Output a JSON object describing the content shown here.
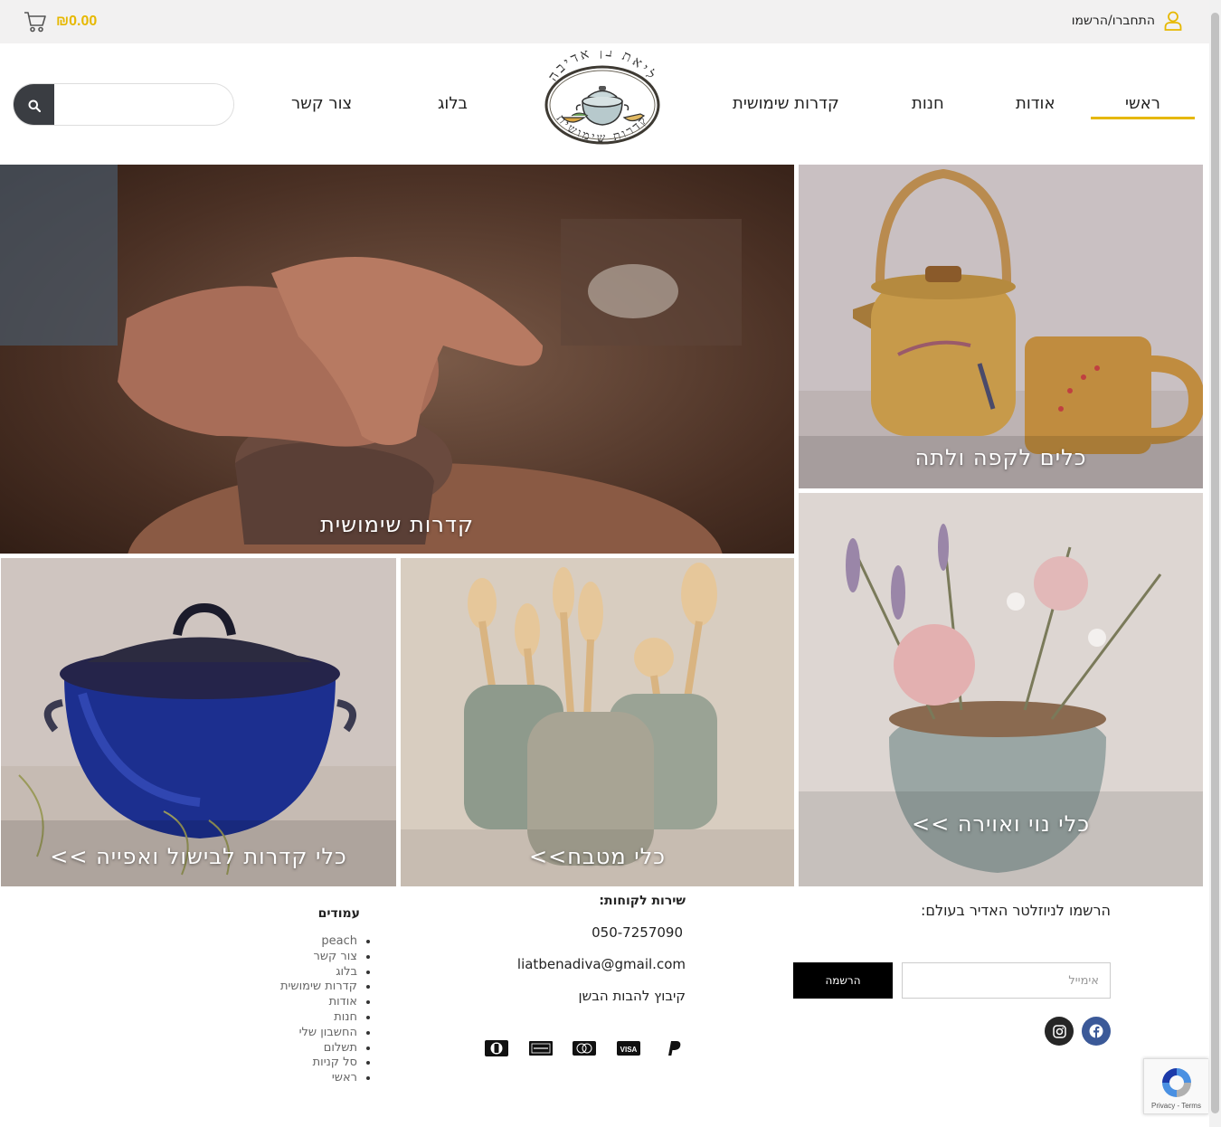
{
  "topbar": {
    "cart_total": "₪0.00",
    "account_label": "התחברו/הרשמו",
    "icons": [
      "cart-icon",
      "user-icon"
    ]
  },
  "header": {
    "logo_name": "ליאת בן אדיבה",
    "logo_tagline": "קדרות שימושית",
    "search_placeholder": "",
    "nav": {
      "home": "ראשי",
      "about": "אודות",
      "shop": "חנות",
      "pottery": "קדרות שימושית",
      "blog": "בלוג",
      "contact": "צור קשר"
    },
    "accent_color": "#e6b800"
  },
  "tiles": {
    "pottery": "קדרות שימושית",
    "coffee_tea": "כלים לקפה ולתה",
    "decor": "כלי נוי ואוירה >>",
    "kitchen": "כלי מטבח>>",
    "cooking": "כלי קדרות לבישול ואפייה >>"
  },
  "footer": {
    "newsletter_title": "הרשמו לניוזלטר האדיר בעולם:",
    "email_placeholder": "אימייל",
    "subscribe_label": "הרשמה",
    "service_title": "שירות לקוחות:",
    "phone": "050-7257090",
    "email": "liatbenadiva@gmail.com",
    "address": "קיבוץ להבות הבשן",
    "payment_icons": [
      "paypal-icon",
      "visa-icon",
      "mastercard-icon",
      "amex-icon",
      "diners-icon"
    ],
    "pages_title": "עמודים",
    "pages": [
      "peach",
      "צור קשר",
      "בלוג",
      "קדרות שימושית",
      "אודות",
      "חנות",
      "החשבון שלי",
      "תשלום",
      "סל קניות",
      "ראשי"
    ],
    "social_icons": [
      "facebook-icon",
      "instagram-icon"
    ],
    "recaptcha_text": "Privacy - Terms"
  }
}
